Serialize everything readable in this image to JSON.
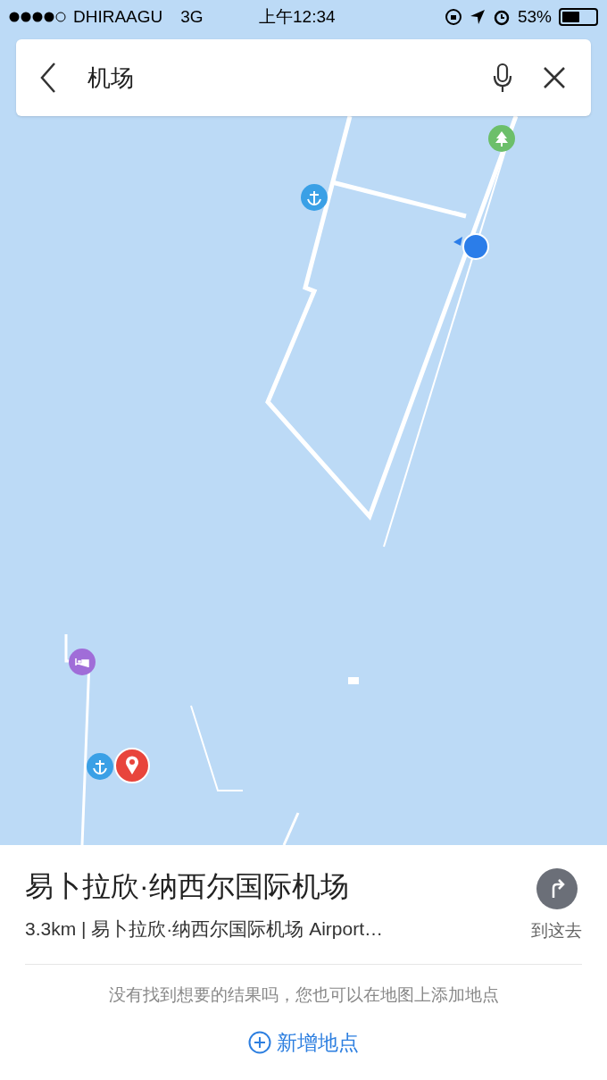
{
  "status_bar": {
    "carrier": "DHIRAAGU",
    "network": "3G",
    "time": "上午12:34",
    "battery": "53%"
  },
  "search": {
    "value": "机场"
  },
  "result": {
    "title": "易卜拉欣·纳西尔国际机场",
    "detail": "3.3km | 易卜拉欣·纳西尔国际机场 Airport…",
    "action": "到这去"
  },
  "footer": {
    "hint": "没有找到想要的结果吗，您也可以在地图上添加地点",
    "add_button": "新增地点"
  }
}
